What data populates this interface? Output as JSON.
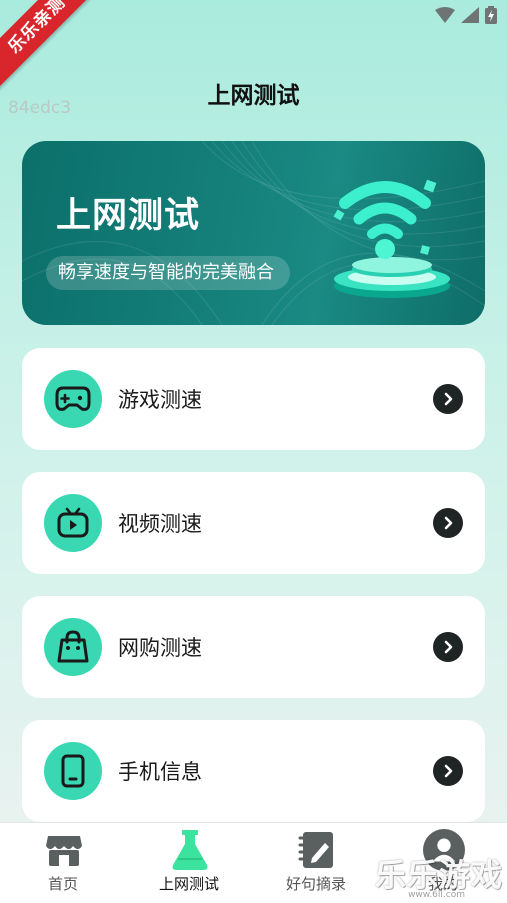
{
  "status_bar": {
    "icons": [
      "wifi-icon",
      "signal-icon",
      "battery-icon"
    ]
  },
  "overlay": {
    "ribbon_text": "乐乐亲测",
    "build_id": "84edc3",
    "watermark": "乐乐游戏",
    "watermark_url": "www.6ll.com"
  },
  "header": {
    "title": "上网测试"
  },
  "hero": {
    "title": "上网测试",
    "subtitle": "畅享速度与智能的完美融合"
  },
  "cards": [
    {
      "label": "游戏测速",
      "icon": "gamepad-icon"
    },
    {
      "label": "视频测速",
      "icon": "video-tv-icon"
    },
    {
      "label": "网购测速",
      "icon": "shopping-bag-icon"
    },
    {
      "label": "手机信息",
      "icon": "phone-icon"
    }
  ],
  "tabbar": {
    "tabs": [
      {
        "label": "首页",
        "icon": "store-icon",
        "active": false
      },
      {
        "label": "上网测试",
        "icon": "flask-icon",
        "active": true
      },
      {
        "label": "好句摘录",
        "icon": "notebook-pen-icon",
        "active": false
      },
      {
        "label": "我的",
        "icon": "user-icon",
        "active": false
      }
    ]
  },
  "colors": {
    "accent": "#39d8b3",
    "hero_bg": "#147e78",
    "arrow_bg": "#1f2424"
  }
}
